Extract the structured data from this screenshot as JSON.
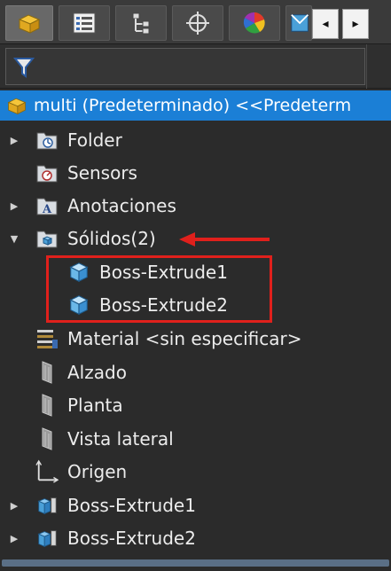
{
  "toolbar": {
    "tabs": [
      {
        "icon": "part-icon",
        "active": true
      },
      {
        "icon": "property-manager-icon",
        "active": false
      },
      {
        "icon": "configuration-manager-icon",
        "active": false
      },
      {
        "icon": "dimxpert-icon",
        "active": false
      },
      {
        "icon": "appearance-icon",
        "active": false
      },
      {
        "icon": "display-pane-icon",
        "active": false
      }
    ],
    "scroll_left": "◂",
    "scroll_right": "▸"
  },
  "filter": {
    "icon": "filter-icon"
  },
  "root": {
    "label": "multi  (Predeterminado) <<Predeterm"
  },
  "tree": {
    "folder": "Folder",
    "sensors": "Sensors",
    "annotations": "Anotaciones",
    "solids": "Sólidos(2)",
    "solid_1": "Boss-Extrude1",
    "solid_2": "Boss-Extrude2",
    "material": "Material <sin especificar>",
    "front": "Alzado",
    "top": "Planta",
    "right": "Vista lateral",
    "origin": "Origen",
    "feature_1": "Boss-Extrude1",
    "feature_2": "Boss-Extrude2"
  },
  "colors": {
    "selection": "#1b7fd6",
    "callout": "#e0201c",
    "background": "#2b2b2b"
  }
}
